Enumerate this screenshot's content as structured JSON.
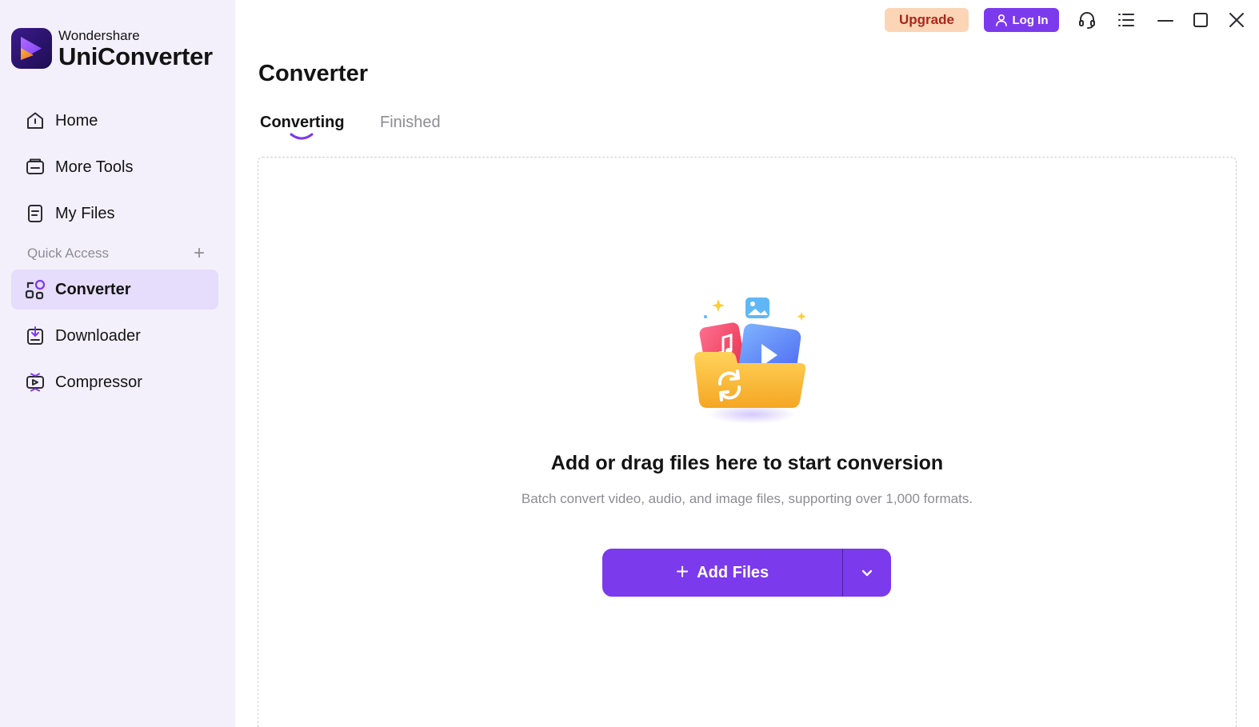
{
  "brand": {
    "sub": "Wondershare",
    "main": "UniConverter"
  },
  "sidebar": {
    "items": [
      {
        "label": "Home",
        "icon": "home-icon"
      },
      {
        "label": "More Tools",
        "icon": "toolbox-icon"
      },
      {
        "label": "My Files",
        "icon": "file-icon"
      }
    ],
    "quick_access_label": "Quick Access",
    "quick_items": [
      {
        "label": "Converter",
        "icon": "converter-icon",
        "active": true
      },
      {
        "label": "Downloader",
        "icon": "downloader-icon"
      },
      {
        "label": "Compressor",
        "icon": "compressor-icon"
      }
    ]
  },
  "topbar": {
    "upgrade_label": "Upgrade",
    "login_label": "Log In",
    "icons": [
      "headset-icon",
      "menu-icon",
      "minimize-icon",
      "maximize-icon",
      "close-icon"
    ]
  },
  "main": {
    "title": "Converter",
    "tabs": [
      {
        "label": "Converting",
        "active": true
      },
      {
        "label": "Finished",
        "active": false
      }
    ],
    "dropzone": {
      "headline": "Add or drag files here to start conversion",
      "subline": "Batch convert video, audio, and image files, supporting over 1,000 formats.",
      "add_button_label": "Add Files"
    }
  },
  "colors": {
    "accent": "#7c3aed",
    "sidebar_bg": "#f3f0fb",
    "active_item_bg": "#e6dcfb",
    "upgrade_bg": "#fbd5b5",
    "upgrade_text": "#a8281c"
  }
}
